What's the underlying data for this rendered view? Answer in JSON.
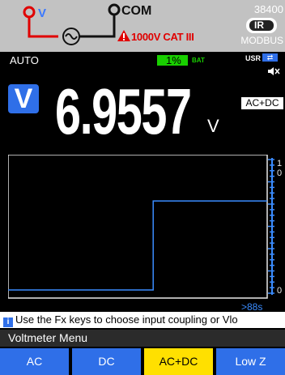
{
  "colors": {
    "panel_gray": "#c2c2c2",
    "red": "#e00000",
    "blue": "#2f6fe8",
    "trace": "#3a8cff",
    "battery_green": "#19d000",
    "active_key": "#ffe000"
  },
  "header": {
    "input_v_label": "V",
    "input_com_label": "COM",
    "category_label": "1000V CAT III",
    "model": "38400",
    "ir_label": "IR",
    "protocol": "MODBUS",
    "icons": [
      "ac-source-icon",
      "warning-triangle-icon",
      "ir-icon"
    ]
  },
  "status": {
    "range_mode": "AUTO",
    "battery_percent": "1%",
    "battery_label": "BAT",
    "usr_label": "USR",
    "icons": [
      "usb-icon",
      "speaker-mute-icon"
    ]
  },
  "measurement": {
    "function_icon": "V",
    "value": "6.9557",
    "unit": "V",
    "coupling": "AC+DC"
  },
  "graph": {
    "time_window": ">88s",
    "step_fraction": 0.56,
    "low_level": 0.0,
    "high_level": 0.7,
    "scale_top_label": "1",
    "scale_bottom_label": "0"
  },
  "help": {
    "text": "Use the Fx keys to choose input coupling or Vlo"
  },
  "menu": {
    "title": "Voltmeter Menu",
    "keys": [
      {
        "label": "AC",
        "active": false
      },
      {
        "label": "DC",
        "active": false
      },
      {
        "label": "AC+DC",
        "active": true
      },
      {
        "label": "Low Z",
        "active": false
      }
    ]
  }
}
